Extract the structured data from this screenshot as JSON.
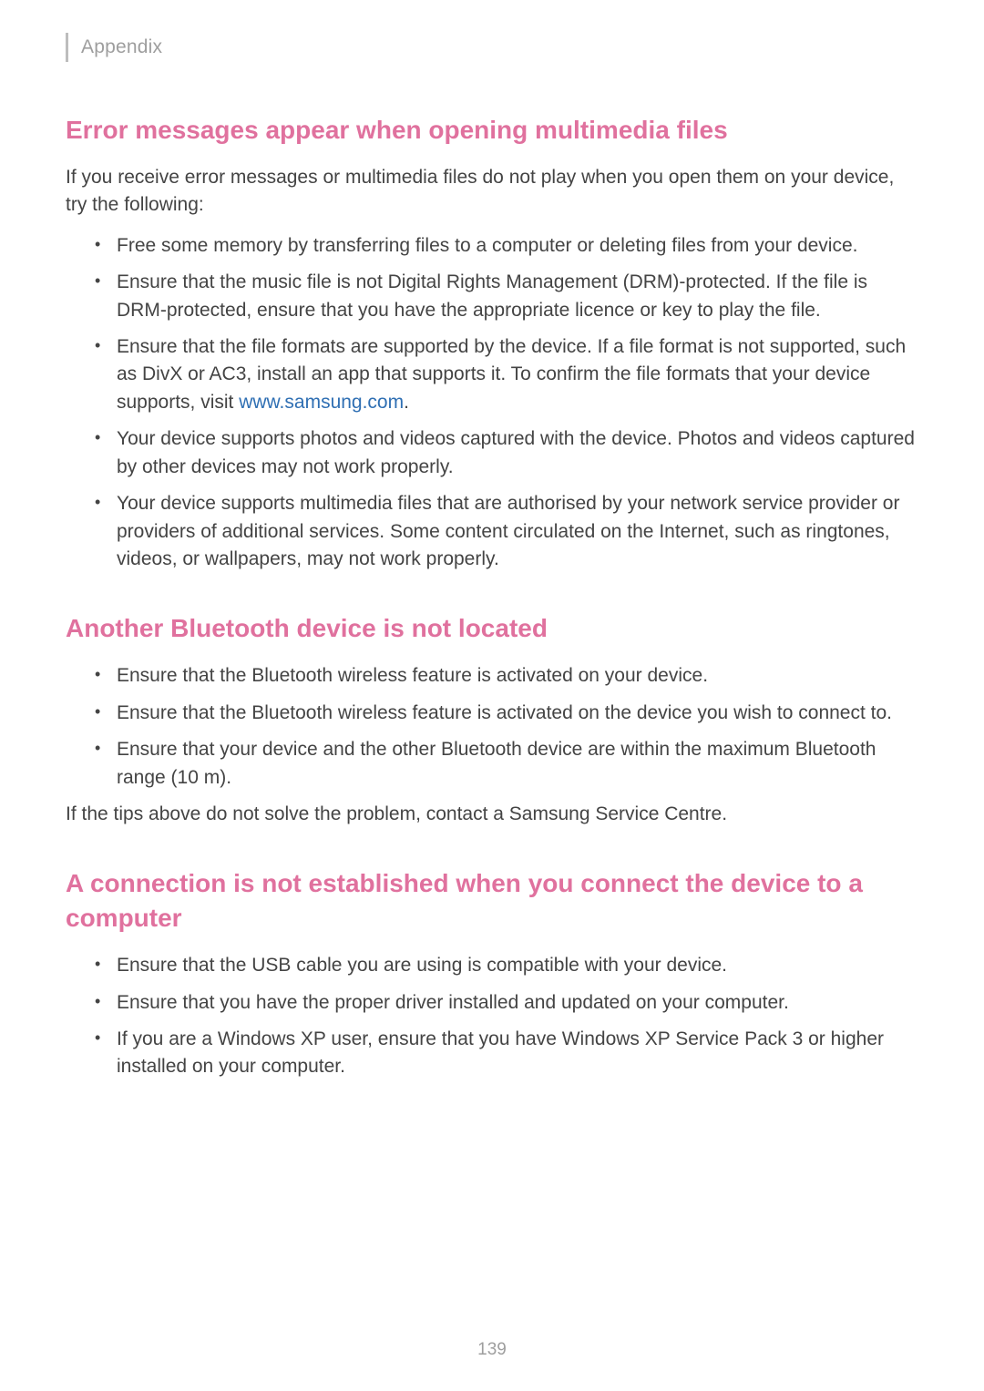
{
  "header": {
    "section_label": "Appendix"
  },
  "sections": [
    {
      "heading": "Error messages appear when opening multimedia files",
      "intro": "If you receive error messages or multimedia files do not play when you open them on your device, try the following:",
      "bullets": [
        {
          "text": "Free some memory by transferring files to a computer or deleting files from your device."
        },
        {
          "text": "Ensure that the music file is not Digital Rights Management (DRM)-protected. If the file is DRM-protected, ensure that you have the appropriate licence or key to play the file."
        },
        {
          "text_pre": "Ensure that the file formats are supported by the device. If a file format is not supported, such as DivX or AC3, install an app that supports it. To confirm the file formats that your device supports, visit ",
          "link_text": "www.samsung.com",
          "text_post": "."
        },
        {
          "text": "Your device supports photos and videos captured with the device. Photos and videos captured by other devices may not work properly."
        },
        {
          "text": "Your device supports multimedia files that are authorised by your network service provider or providers of additional services. Some content circulated on the Internet, such as ringtones, videos, or wallpapers, may not work properly."
        }
      ]
    },
    {
      "heading": "Another Bluetooth device is not located",
      "bullets": [
        {
          "text": "Ensure that the Bluetooth wireless feature is activated on your device."
        },
        {
          "text": "Ensure that the Bluetooth wireless feature is activated on the device you wish to connect to."
        },
        {
          "text": "Ensure that your device and the other Bluetooth device are within the maximum Bluetooth range (10 m)."
        }
      ],
      "closing": "If the tips above do not solve the problem, contact a Samsung Service Centre."
    },
    {
      "heading": "A connection is not established when you connect the device to a computer",
      "bullets": [
        {
          "text": "Ensure that the USB cable you are using is compatible with your device."
        },
        {
          "text": "Ensure that you have the proper driver installed and updated on your computer."
        },
        {
          "text": "If you are a Windows XP user, ensure that you have Windows XP Service Pack 3 or higher installed on your computer."
        }
      ]
    }
  ],
  "page_number": "139"
}
